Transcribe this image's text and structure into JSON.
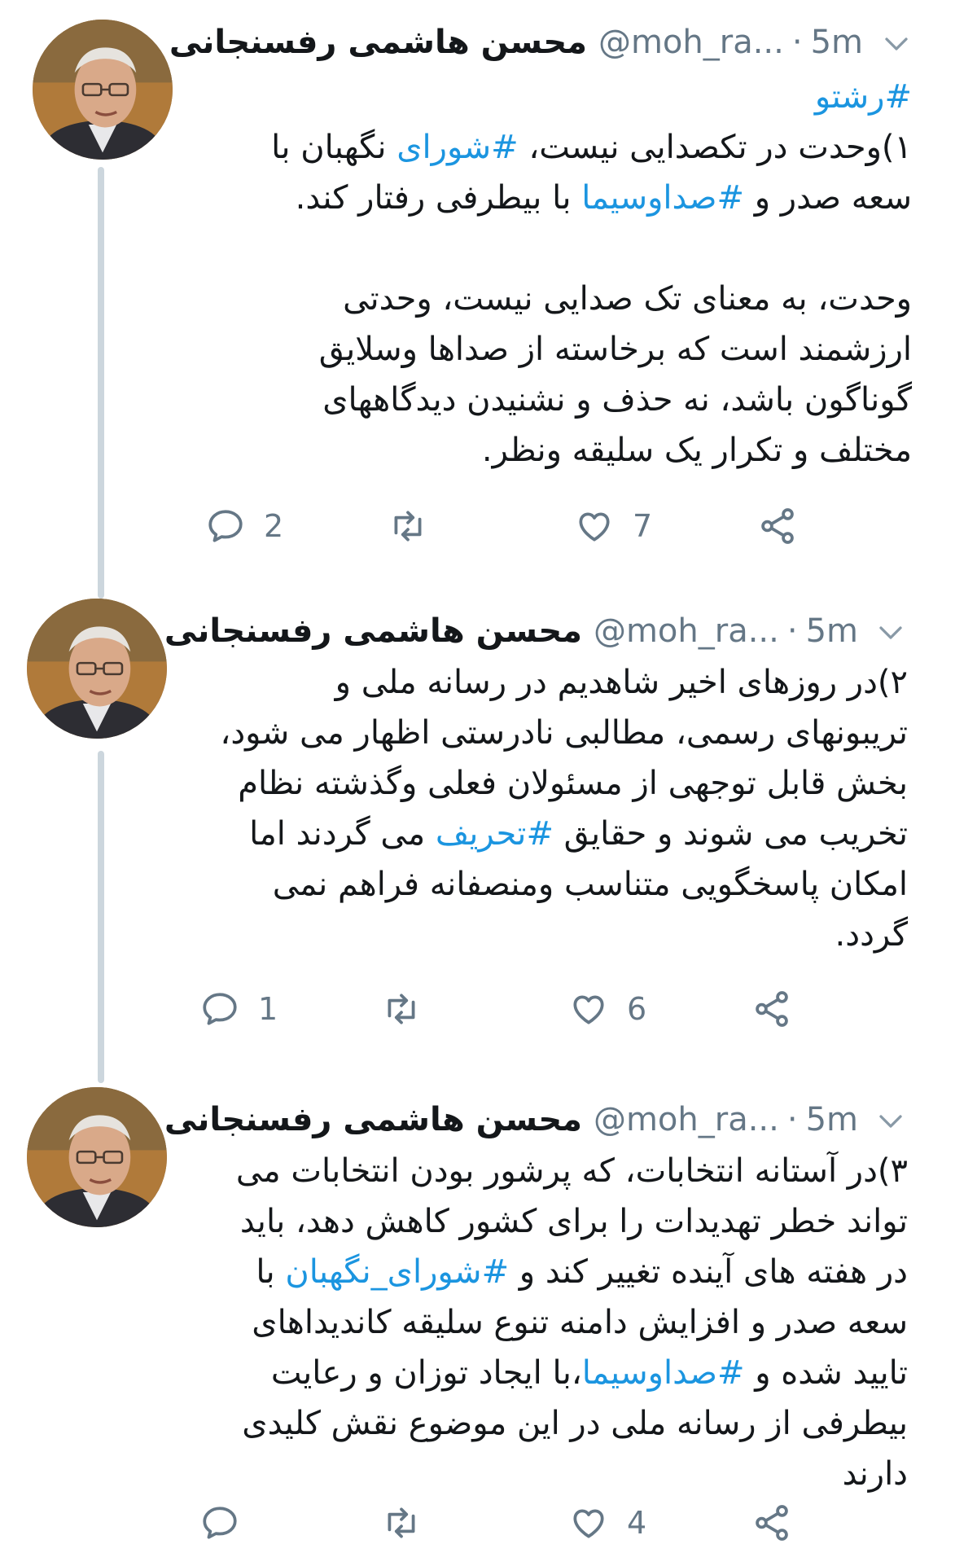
{
  "tweets": [
    {
      "name": "محسن هاشمی رفسنجانی",
      "handle": "@moh_ra...",
      "time": "5m",
      "hashtag_line": "#رشتو",
      "paragraph1": [
        {
          "text": "۱)وحدت در تکصدایی نیست، ",
          "tag": false
        },
        {
          "text": "#شورای",
          "tag": true
        },
        {
          "text": " نگهبان با سعه صدر و ",
          "tag": false
        },
        {
          "text": "#صداوسیما",
          "tag": true
        },
        {
          "text": " با بیطرفی رفتار کند.",
          "tag": false
        }
      ],
      "paragraph2": "وحدت، به معنای تک صدایی نیست، وحدتی ارزشمند است که برخاسته از صداها وسلایق گوناگون باشد، نه حذف و نشنیدن دیدگاههای مختلف و تکرار یک سلیقه ونظر.",
      "replies": "2",
      "retweets": "",
      "likes": "7"
    },
    {
      "name": "محسن هاشمی رفسنجانی",
      "handle": "@moh_ra...",
      "time": "5m",
      "paragraph1": [
        {
          "text": "۲)در روزهای اخیر شاهدیم در رسانه ملی و تریبونهای رسمی، مطالبی نادرستی اظهار می شود، بخش قابل توجهی از مسئولان فعلی وگذشته نظام تخریب می شوند و حقایق ",
          "tag": false
        },
        {
          "text": "#تحریف",
          "tag": true
        },
        {
          "text": " می گردند اما امکان پاسخگویی متناسب ومنصفانه فراهم نمی گردد.",
          "tag": false
        }
      ],
      "replies": "1",
      "retweets": "",
      "likes": "6"
    },
    {
      "name": "محسن هاشمی رفسنجانی",
      "handle": "@moh_ra...",
      "time": "5m",
      "paragraph1": [
        {
          "text": "۳)در آستانه انتخابات، که پرشور بودن انتخابات می تواند خطر تهدیدات را برای کشور کاهش دهد، باید در هفته های آینده تغییر کند و ",
          "tag": false
        },
        {
          "text": "#شورای_نگهبان",
          "tag": true
        },
        {
          "text": " با سعه صدر و افزایش دامنه تنوع سلیقه کاندیداهای تایید شده و ",
          "tag": false
        },
        {
          "text": "#صداوسیما",
          "tag": true
        },
        {
          "text": "،با ایجاد توزان و رعایت بیطرفی از رسانه ملی در این موضوع نقش کلیدی دارند",
          "tag": false
        }
      ],
      "replies": "",
      "retweets": "",
      "likes": "4"
    }
  ],
  "icons": {
    "reply": "reply-icon",
    "retweet": "retweet-icon",
    "like": "heart-icon",
    "share": "share-icon",
    "menu": "chevron-down-icon"
  },
  "colors": {
    "hashtag": "#1b95e0",
    "muted": "#657786",
    "thread_line": "#ccd6dd"
  }
}
